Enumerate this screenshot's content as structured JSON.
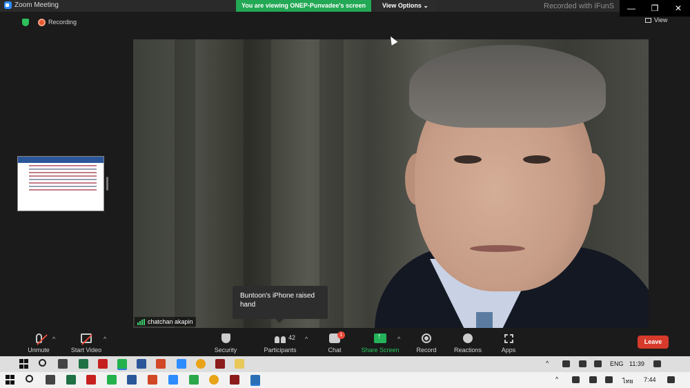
{
  "window": {
    "title": "Zoom Meeting",
    "share_banner": "You are viewing ONEP-Punvadee's screen",
    "view_options": "View Options",
    "watermark": "Recorded with iFunS"
  },
  "status": {
    "recording_label": "Recording",
    "view_label": "View"
  },
  "video": {
    "participant_name": "chatchan akapin"
  },
  "notification": {
    "text": "Buntoon's iPhone raised hand"
  },
  "toolbar": {
    "unmute": "Unmute",
    "start_video": "Start Video",
    "security": "Security",
    "participants": "Participants",
    "participants_count": "42",
    "chat": "Chat",
    "chat_badge": "1",
    "share_screen": "Share Screen",
    "record": "Record",
    "reactions": "Reactions",
    "apps": "Apps",
    "leave": "Leave"
  },
  "taskbar_top": {
    "language": "ENG",
    "time": "11:39"
  },
  "taskbar_bottom": {
    "language": "ไทย",
    "time": "7:44"
  },
  "colors": {
    "banner_green": "#23a855",
    "leave_red": "#d63a2b",
    "share_green": "#23b45a",
    "recording_orange": "#e9572c"
  }
}
